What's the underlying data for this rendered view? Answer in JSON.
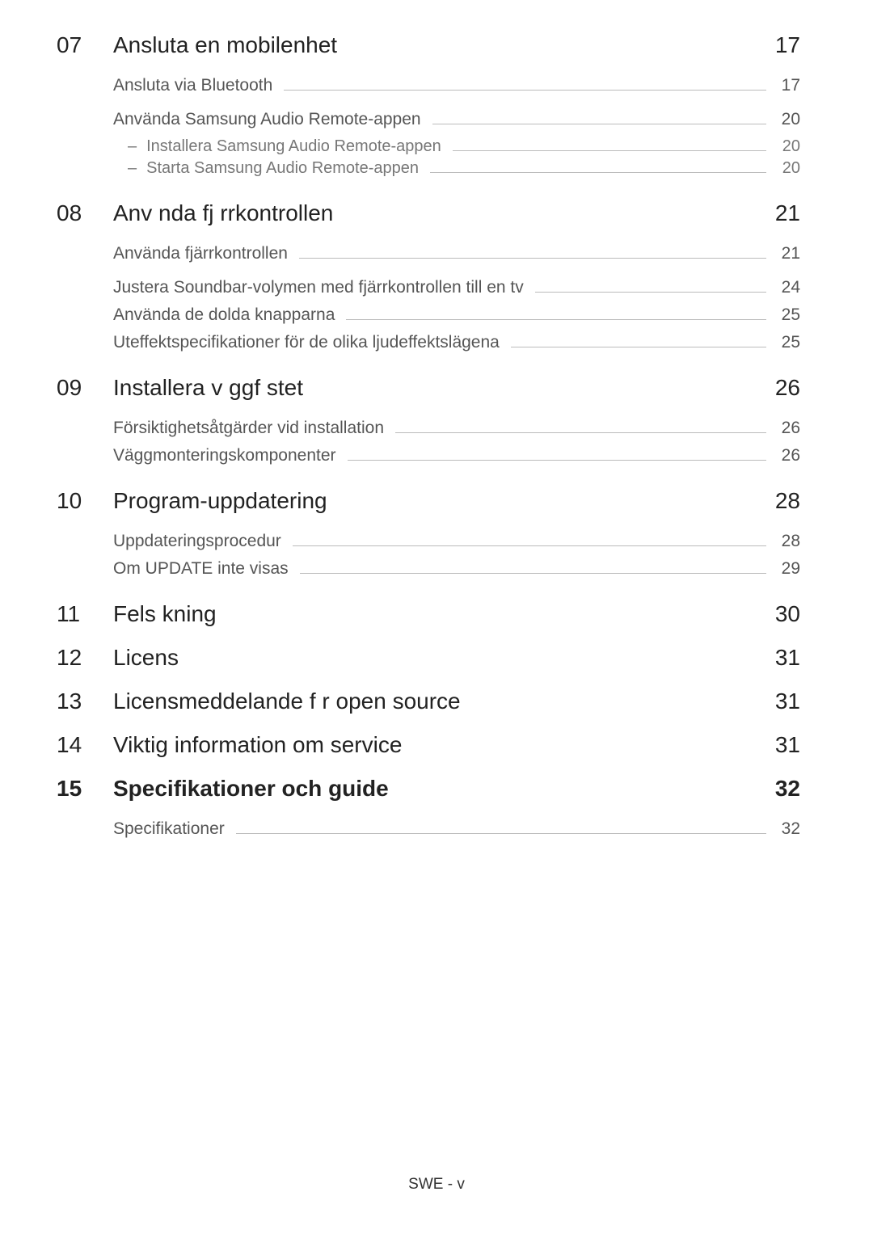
{
  "footer": "SWE - v",
  "sections": [
    {
      "num": "07",
      "title": "Ansluta en mobilenhet",
      "page": "17",
      "bold": false,
      "groups": [
        {
          "entries": [
            {
              "title": "Ansluta via Bluetooth",
              "page": "17",
              "subs": []
            }
          ]
        },
        {
          "entries": [
            {
              "title": "Använda Samsung Audio Remote-appen",
              "page": "20",
              "subs": [
                {
                  "title": "Installera Samsung Audio Remote-appen",
                  "page": "20"
                },
                {
                  "title": "Starta Samsung Audio Remote-appen",
                  "page": "20"
                }
              ]
            }
          ]
        }
      ]
    },
    {
      "num": "08",
      "title": "Anv nda fj rrkontrollen",
      "page": "21",
      "bold": false,
      "groups": [
        {
          "entries": [
            {
              "title": "Använda fjärrkontrollen",
              "page": "21",
              "subs": []
            }
          ]
        },
        {
          "entries": [
            {
              "title": "Justera Soundbar-volymen med fjärrkontrollen till en tv",
              "page": "24",
              "subs": []
            },
            {
              "title": "Använda de dolda knapparna",
              "page": "25",
              "subs": []
            },
            {
              "title": "Uteffektspecifikationer för de olika ljudeffektslägena",
              "page": "25",
              "subs": []
            }
          ]
        }
      ]
    },
    {
      "num": "09",
      "title": "Installera v ggf stet",
      "page": "26",
      "bold": false,
      "groups": [
        {
          "entries": [
            {
              "title": "Försiktighetsåtgärder vid installation",
              "page": "26",
              "subs": []
            },
            {
              "title": "Väggmonteringskomponenter",
              "page": "26",
              "subs": []
            }
          ]
        }
      ]
    },
    {
      "num": "10",
      "title": "Program-uppdatering",
      "page": "28",
      "bold": false,
      "groups": [
        {
          "entries": [
            {
              "title": "Uppdateringsprocedur",
              "page": "28",
              "subs": []
            },
            {
              "title": "Om UPDATE inte visas",
              "page": "29",
              "subs": []
            }
          ]
        }
      ]
    },
    {
      "num": "11",
      "title": "Fels kning",
      "page": "30",
      "bold": false,
      "groups": []
    },
    {
      "num": "12",
      "title": "Licens",
      "page": "31",
      "bold": false,
      "groups": []
    },
    {
      "num": "13",
      "title": "Licensmeddelande f r open source",
      "page": "31",
      "bold": false,
      "groups": []
    },
    {
      "num": "14",
      "title": "Viktig information om service",
      "page": "31",
      "bold": false,
      "groups": []
    },
    {
      "num": "15",
      "title": "Specifikationer och guide",
      "page": "32",
      "bold": true,
      "groups": [
        {
          "entries": [
            {
              "title": "Specifikationer",
              "page": "32",
              "subs": []
            }
          ]
        }
      ]
    }
  ]
}
